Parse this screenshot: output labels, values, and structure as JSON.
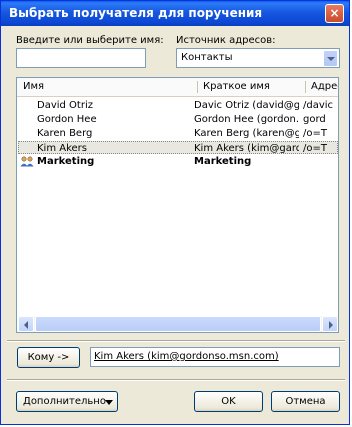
{
  "dialog": {
    "title": "Выбрать получателя для поручения",
    "close_label": "×"
  },
  "search": {
    "label": "Введите или выберите имя:",
    "value": ""
  },
  "source": {
    "label": "Источник адресов:",
    "value": "Контакты"
  },
  "list": {
    "columns": [
      "Имя",
      "Краткое имя",
      "Адрес"
    ],
    "rows": [
      {
        "name": "David Otriz",
        "short": "Davic Otriz (david@g...",
        "addr": "/davic"
      },
      {
        "name": "Gordon Hee",
        "short": "Gordon Hee (gordon...",
        "addr": "gord"
      },
      {
        "name": "Karen Berg",
        "short": "Karen Berg (karen@g...",
        "addr": "/o=T"
      },
      {
        "name": "Kim Akers",
        "short": "Kim Akers (kim@gard...",
        "addr": "/o=T"
      },
      {
        "name": "Marketing",
        "short": "Marketing",
        "addr": ""
      }
    ]
  },
  "to": {
    "button_label": "Кому ->",
    "value": "Kim Akers (kim@gordonso.msn.com)"
  },
  "footer": {
    "more_label": "Дополнительно",
    "ok_label": "OK",
    "cancel_label": "Отмена"
  }
}
